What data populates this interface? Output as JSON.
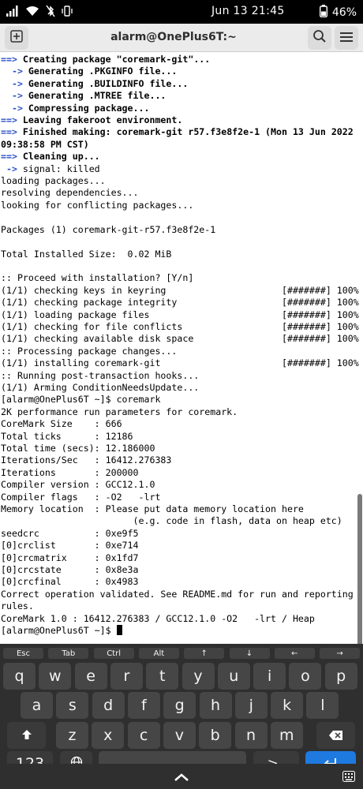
{
  "status_bar": {
    "time": "Jun 13  21:45",
    "battery": "46%",
    "icons": [
      "signal-icon",
      "wifi-icon",
      "bluetooth-off-icon",
      "vibrate-icon",
      "battery-icon"
    ]
  },
  "header": {
    "title": "alarm@OnePlus6T:~",
    "new_tab_icon": "plus-icon",
    "search_icon": "search-icon",
    "menu_icon": "hamburger-menu-icon"
  },
  "terminal": {
    "lines": [
      {
        "marker": "==>",
        "text": " Creating package \"coremark-git\"...",
        "style": "bold"
      },
      {
        "marker": "  ->",
        "text": " Generating .PKGINFO file...",
        "style": "bold"
      },
      {
        "marker": "  ->",
        "text": " Generating .BUILDINFO file...",
        "style": "bold"
      },
      {
        "marker": "  ->",
        "text": " Generating .MTREE file...",
        "style": "bold"
      },
      {
        "marker": "  ->",
        "text": " Compressing package...",
        "style": "bold"
      },
      {
        "marker": "==>",
        "text": " Leaving fakeroot environment.",
        "style": "bold"
      },
      {
        "marker": "==>",
        "text": " Finished making: coremark-git r57.f3e8f2e-1 (Mon 13 Jun 2022",
        "style": "bold"
      },
      {
        "marker": "",
        "text": "09:38:58 PM CST)",
        "style": "bold"
      },
      {
        "marker": "==>",
        "text": " Cleaning up...",
        "style": "bold"
      },
      {
        "marker": " ->",
        "text": " signal: killed",
        "style": "normal"
      },
      {
        "marker": "",
        "text": "loading packages...",
        "style": "normal"
      },
      {
        "marker": "",
        "text": "resolving dependencies...",
        "style": "normal"
      },
      {
        "marker": "",
        "text": "looking for conflicting packages...",
        "style": "normal"
      },
      {
        "marker": "",
        "text": "",
        "style": "normal"
      },
      {
        "marker": "",
        "text": "Packages (1) coremark-git-r57.f3e8f2e-1",
        "style": "normal"
      },
      {
        "marker": "",
        "text": "",
        "style": "normal"
      },
      {
        "marker": "",
        "text": "Total Installed Size:  0.02 MiB",
        "style": "normal"
      },
      {
        "marker": "",
        "text": "",
        "style": "normal"
      },
      {
        "marker": "",
        "text": ":: Proceed with installation? [Y/n]",
        "style": "normal"
      },
      {
        "marker": "",
        "text": "(1/1) checking keys in keyring                     [#######] 100%",
        "style": "normal"
      },
      {
        "marker": "",
        "text": "(1/1) checking package integrity                   [#######] 100%",
        "style": "normal"
      },
      {
        "marker": "",
        "text": "(1/1) loading package files                        [#######] 100%",
        "style": "normal"
      },
      {
        "marker": "",
        "text": "(1/1) checking for file conflicts                  [#######] 100%",
        "style": "normal"
      },
      {
        "marker": "",
        "text": "(1/1) checking available disk space                [#######] 100%",
        "style": "normal"
      },
      {
        "marker": "",
        "text": ":: Processing package changes...",
        "style": "normal"
      },
      {
        "marker": "",
        "text": "(1/1) installing coremark-git                      [#######] 100%",
        "style": "normal"
      },
      {
        "marker": "",
        "text": ":: Running post-transaction hooks...",
        "style": "normal"
      },
      {
        "marker": "",
        "text": "(1/1) Arming ConditionNeedsUpdate...",
        "style": "normal"
      },
      {
        "marker": "",
        "text": "[alarm@OnePlus6T ~]$ coremark",
        "style": "normal"
      },
      {
        "marker": "",
        "text": "2K performance run parameters for coremark.",
        "style": "normal"
      },
      {
        "marker": "",
        "text": "CoreMark Size    : 666",
        "style": "normal"
      },
      {
        "marker": "",
        "text": "Total ticks      : 12186",
        "style": "normal"
      },
      {
        "marker": "",
        "text": "Total time (secs): 12.186000",
        "style": "normal"
      },
      {
        "marker": "",
        "text": "Iterations/Sec   : 16412.276383",
        "style": "normal"
      },
      {
        "marker": "",
        "text": "Iterations       : 200000",
        "style": "normal"
      },
      {
        "marker": "",
        "text": "Compiler version : GCC12.1.0",
        "style": "normal"
      },
      {
        "marker": "",
        "text": "Compiler flags   : -O2   -lrt",
        "style": "normal"
      },
      {
        "marker": "",
        "text": "Memory location  : Please put data memory location here",
        "style": "normal"
      },
      {
        "marker": "",
        "text": "                        (e.g. code in flash, data on heap etc)",
        "style": "normal"
      },
      {
        "marker": "",
        "text": "seedcrc          : 0xe9f5",
        "style": "normal"
      },
      {
        "marker": "",
        "text": "[0]crclist       : 0xe714",
        "style": "normal"
      },
      {
        "marker": "",
        "text": "[0]crcmatrix     : 0x1fd7",
        "style": "normal"
      },
      {
        "marker": "",
        "text": "[0]crcstate      : 0x8e3a",
        "style": "normal"
      },
      {
        "marker": "",
        "text": "[0]crcfinal      : 0x4983",
        "style": "normal"
      },
      {
        "marker": "",
        "text": "Correct operation validated. See README.md for run and reporting",
        "style": "normal"
      },
      {
        "marker": "",
        "text": "rules.",
        "style": "normal"
      },
      {
        "marker": "",
        "text": "CoreMark 1.0 : 16412.276383 / GCC12.1.0 -O2   -lrt / Heap",
        "style": "normal"
      }
    ],
    "prompt": "[alarm@OnePlus6T ~]$ "
  },
  "keyboard": {
    "function_keys": [
      "Esc",
      "Tab",
      "Ctrl",
      "Alt",
      "↑",
      "↓",
      "←",
      "→"
    ],
    "row1": [
      "q",
      "w",
      "e",
      "r",
      "t",
      "y",
      "u",
      "i",
      "o",
      "p"
    ],
    "row2": [
      "a",
      "s",
      "d",
      "f",
      "g",
      "h",
      "j",
      "k",
      "l"
    ],
    "row3": [
      "z",
      "x",
      "c",
      "v",
      "b",
      "n",
      "m"
    ],
    "numbers_key": "123",
    "terminal_key": ">_",
    "enter_icon": "enter-icon",
    "shift_icon": "shift-icon",
    "backspace_icon": "backspace-icon",
    "globe_icon": "globe-icon",
    "space_label": "",
    "colors": {
      "accent": "#1f7ae0",
      "key": "#464646",
      "background": "#2f2f2f"
    }
  },
  "nav_bar": {
    "hide_keyboard_icon": "chevron-up-icon",
    "keyboard_switch_icon": "keyboard-icon"
  }
}
